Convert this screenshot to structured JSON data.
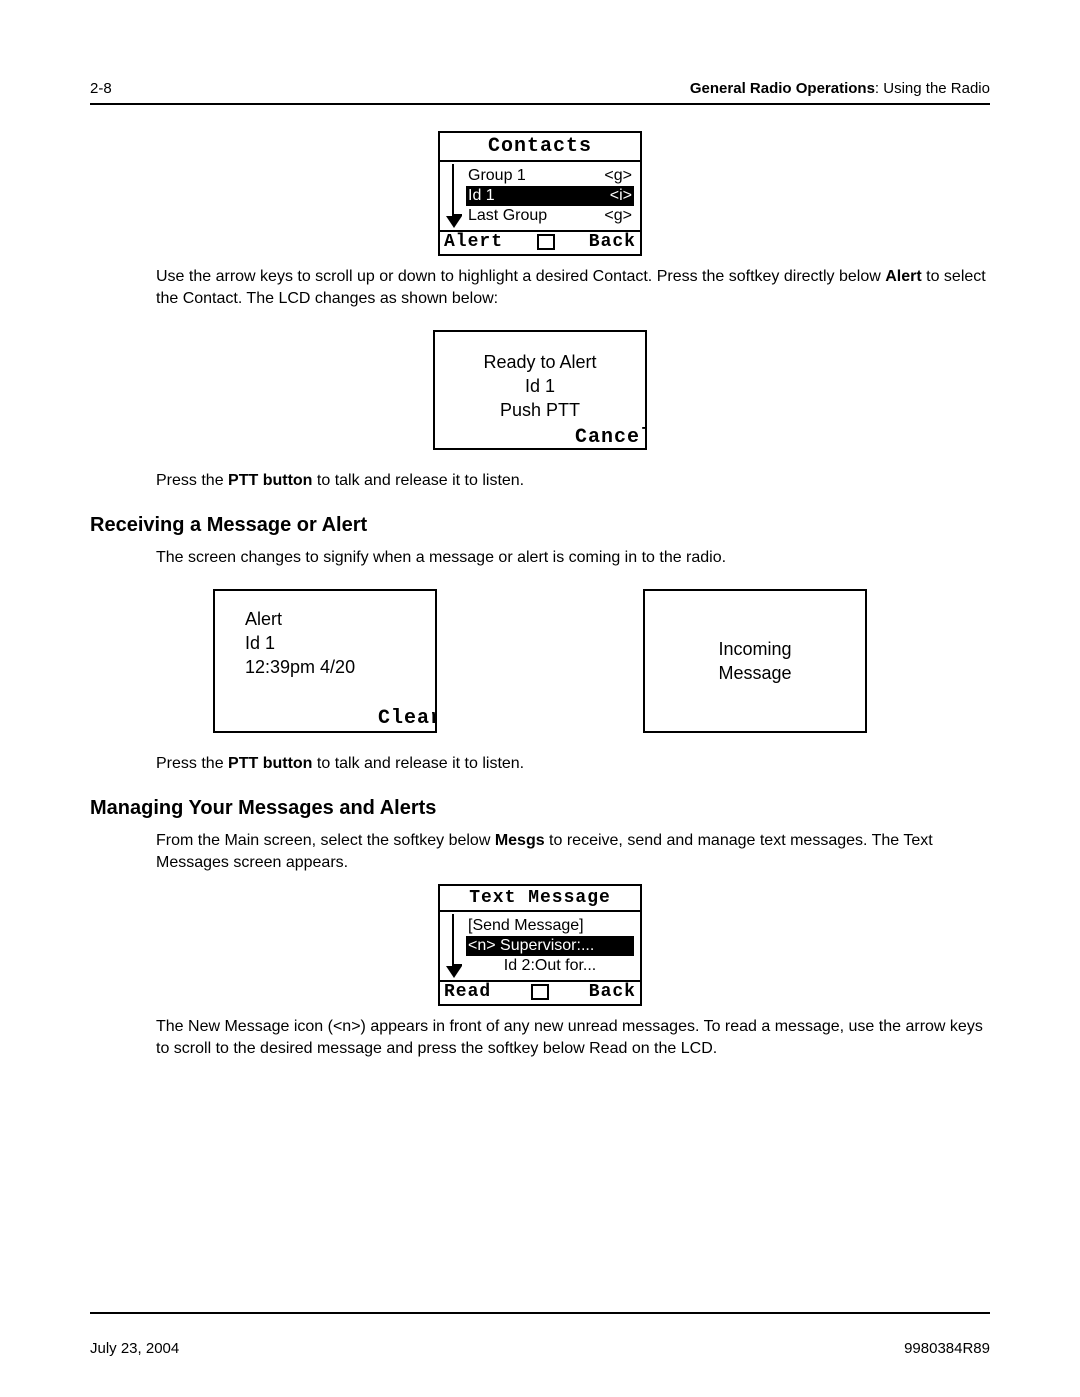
{
  "header": {
    "page_num": "2-8",
    "section_bold": "General Radio Operations",
    "section_rest": ": Using the Radio"
  },
  "lcd_contacts": {
    "title": "Contacts",
    "rows": [
      {
        "label": "Group 1",
        "tag": "<g>",
        "selected": false
      },
      {
        "label": "Id 1",
        "tag": "<i>",
        "selected": true
      },
      {
        "label": "Last Group",
        "tag": "<g>",
        "selected": false
      }
    ],
    "soft_left": "Alert",
    "soft_right": "Back"
  },
  "para1_a": "Use the arrow keys to scroll up or down to highlight a desired Contact. Press the softkey directly below ",
  "para1_b": "Alert",
  "para1_c": " to select the Contact. The LCD changes as shown below:",
  "lcd_ready": {
    "line1": "Ready to Alert",
    "line2": "Id 1",
    "line3": "Push PTT",
    "soft_right": "Cancel"
  },
  "para2_a": "Press the ",
  "para2_b": "PTT button",
  "para2_c": " to talk and release it to listen.",
  "heading1": "Receiving a Message or Alert",
  "para3": "The screen changes to signify when a message or alert is coming in to the radio.",
  "lcd_alert": {
    "line1": "Alert",
    "line2": "Id 1",
    "line3": "12:39pm 4/20",
    "soft_right": "Clear"
  },
  "lcd_incoming": {
    "line1": "Incoming",
    "line2": "Message"
  },
  "para4_a": "Press the ",
  "para4_b": "PTT button",
  "para4_c": " to talk and release it to listen.",
  "heading2": "Managing Your Messages and Alerts",
  "para5_a": "From the Main screen, select the softkey below ",
  "para5_b": "Mesgs",
  "para5_c": " to receive, send and manage text messages. The Text Messages screen appears.",
  "lcd_text": {
    "title": "Text Message",
    "rows": [
      {
        "label": "[Send Message]",
        "selected": false
      },
      {
        "label": "<n> Supervisor:...",
        "selected": true
      },
      {
        "label": "Id 2:Out for...",
        "selected": false
      }
    ],
    "soft_left": "Read",
    "soft_right": "Back"
  },
  "para6": "The New Message icon (<n>) appears in front of any new unread messages. To read a message, use the arrow keys to scroll to the desired message and press the softkey below Read on the LCD.",
  "footer": {
    "date": "July 23, 2004",
    "docnum": "9980384R89"
  }
}
